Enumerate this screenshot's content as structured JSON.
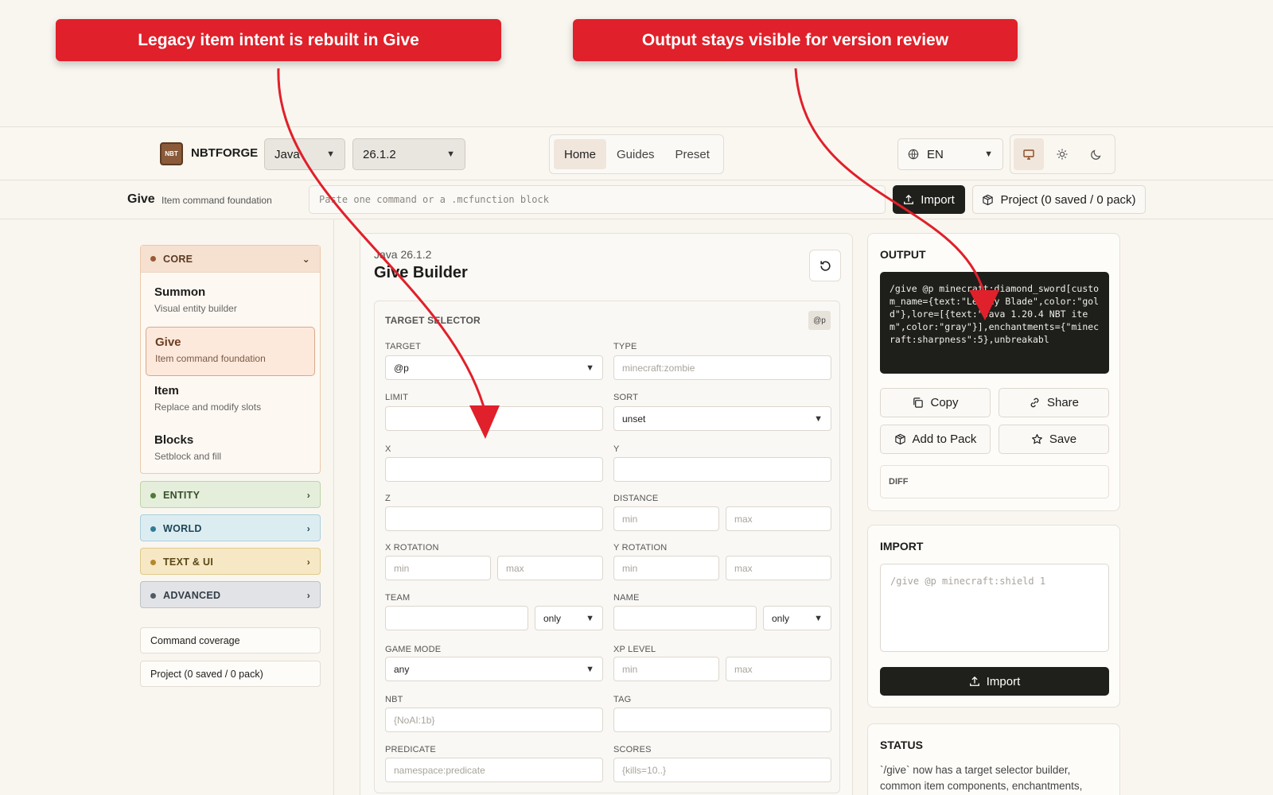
{
  "annotations": {
    "left": "Legacy item intent is rebuilt in Give",
    "right": "Output stays visible for version review"
  },
  "topnav": {
    "logo_text": "NBT",
    "brand": "NBTFORGE",
    "edition": "Java",
    "version": "26.1.2",
    "tabs": [
      "Home",
      "Guides",
      "Preset"
    ],
    "active_tab": "Home",
    "language": "EN"
  },
  "commandbar": {
    "title": "Give",
    "subtitle": "Item command foundation",
    "input_placeholder": "Paste one command or a .mcfunction block",
    "import_label": "Import",
    "project_label": "Project (0 saved / 0 pack)"
  },
  "sidebar": {
    "core": {
      "label": "CORE",
      "items": [
        {
          "title": "Summon",
          "subtitle": "Visual entity builder"
        },
        {
          "title": "Give",
          "subtitle": "Item command foundation"
        },
        {
          "title": "Item",
          "subtitle": "Replace and modify slots"
        },
        {
          "title": "Blocks",
          "subtitle": "Setblock and fill"
        }
      ]
    },
    "entity": "ENTITY",
    "world": "WORLD",
    "text_ui": "TEXT & UI",
    "advanced": "ADVANCED",
    "coverage": "Command coverage",
    "project": "Project (0 saved / 0 pack)"
  },
  "builder": {
    "version": "Java 26.1.2",
    "title": "Give Builder",
    "section_title": "TARGET SELECTOR",
    "badge": "@p",
    "fields": {
      "target_label": "TARGET",
      "target_value": "@p",
      "type_label": "TYPE",
      "type_placeholder": "minecraft:zombie",
      "limit_label": "LIMIT",
      "sort_label": "SORT",
      "sort_value": "unset",
      "x_label": "X",
      "y_label": "Y",
      "z_label": "Z",
      "distance_label": "DISTANCE",
      "min": "min",
      "max": "max",
      "xrot_label": "X ROTATION",
      "yrot_label": "Y ROTATION",
      "team_label": "TEAM",
      "team_mode": "only",
      "name_label": "NAME",
      "name_mode": "only",
      "gamemode_label": "GAME MODE",
      "gamemode_value": "any",
      "xp_label": "XP LEVEL",
      "nbt_label": "NBT",
      "nbt_placeholder": "{NoAI:1b}",
      "tag_label": "TAG",
      "predicate_label": "PREDICATE",
      "predicate_placeholder": "namespace:predicate",
      "scores_label": "SCORES",
      "scores_placeholder": "{kills=10..}"
    }
  },
  "output": {
    "title": "OUTPUT",
    "code": "/give @p minecraft:diamond_sword[custom_name={text:\"Legacy Blade\",color:\"gold\"},lore=[{text:\"Java 1.20.4 NBT item\",color:\"gray\"}],enchantments={\"minecraft:sharpness\":5},unbreakabl",
    "copy": "Copy",
    "share": "Share",
    "add_to_pack": "Add to Pack",
    "save": "Save",
    "diff": "DIFF"
  },
  "import": {
    "title": "IMPORT",
    "placeholder": "/give @p minecraft:shield 1",
    "button": "Import"
  },
  "status": {
    "title": "STATUS",
    "text": "`/give` now has a target selector builder, common item components, enchantments,"
  },
  "colors": {
    "accent_red": "#e0202a",
    "dark_button": "#1f1f1b",
    "core": "#f6e0d0",
    "entity": "#e4eedb",
    "world": "#dcedf2",
    "text_ui": "#f6e8c4",
    "advanced": "#e1e3e6"
  }
}
